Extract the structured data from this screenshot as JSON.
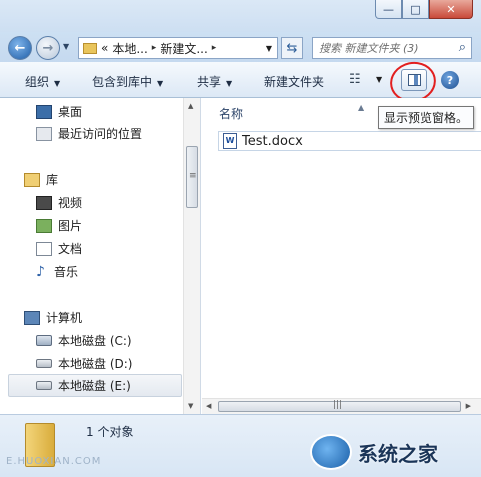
{
  "window": {
    "minimize_glyph": "—",
    "maximize_glyph": "□",
    "close_glyph": "✕"
  },
  "address": {
    "breadcrumb": [
      "«",
      "本地...",
      "新建文..."
    ],
    "search_placeholder": "搜索 新建文件夹 (3)"
  },
  "toolbar": {
    "organize": "组织",
    "include_in_library": "包含到库中",
    "share": "共享",
    "new_folder": "新建文件夹",
    "tooltip": "显示预览窗格。"
  },
  "nav": {
    "favorites": [
      {
        "label": "桌面",
        "icon": "desktop-icon"
      },
      {
        "label": "最近访问的位置",
        "icon": "recent-places-icon"
      }
    ],
    "libraries_header": "库",
    "libraries": [
      {
        "label": "视频",
        "icon": "video-icon"
      },
      {
        "label": "图片",
        "icon": "pictures-icon"
      },
      {
        "label": "文档",
        "icon": "documents-icon"
      },
      {
        "label": "音乐",
        "icon": "music-icon"
      }
    ],
    "computer_header": "计算机",
    "drives": [
      {
        "label": "本地磁盘 (C:)",
        "icon": "system-drive-icon"
      },
      {
        "label": "本地磁盘 (D:)",
        "icon": "drive-icon"
      },
      {
        "label": "本地磁盘 (E:)",
        "icon": "drive-icon",
        "selected": true
      }
    ]
  },
  "files": {
    "column_name": "名称",
    "items": [
      {
        "name": "Test.docx",
        "icon": "word-document-icon"
      }
    ]
  },
  "status": {
    "item_count": "1 个对象"
  },
  "watermark": {
    "url": "E.HUOXIAN.COM",
    "logo_text": "系统之家"
  },
  "colors": {
    "accent": "#3c6ea8",
    "highlight_circle": "#e21f1f"
  }
}
